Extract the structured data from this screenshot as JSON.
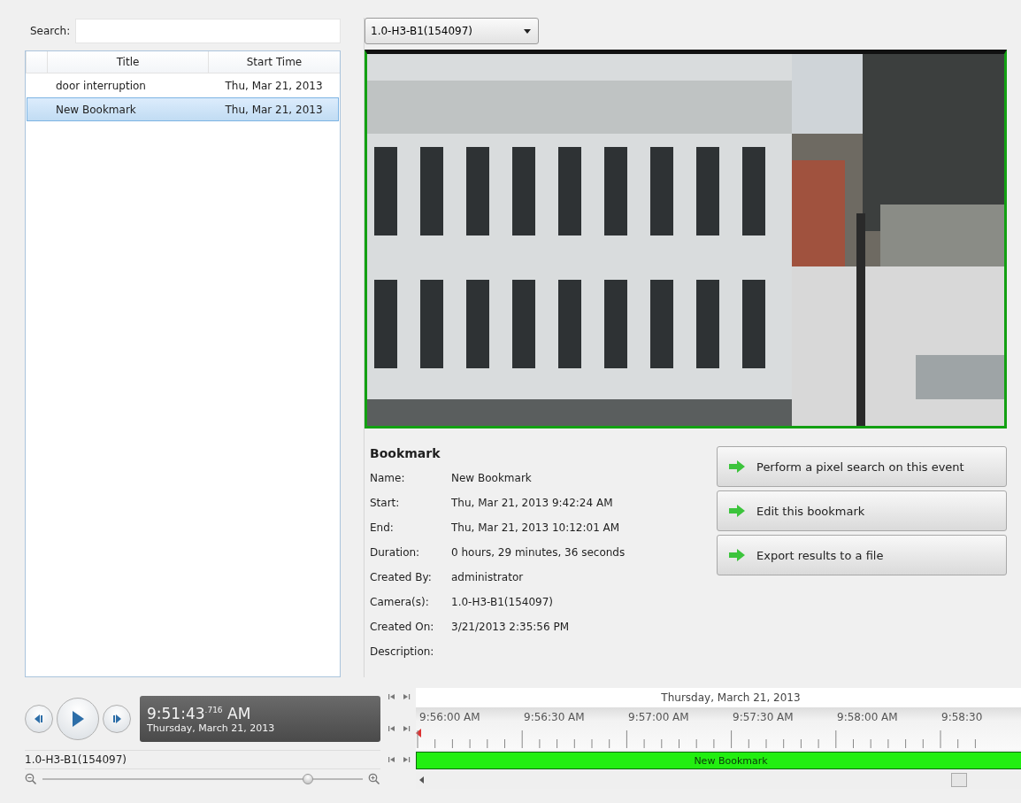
{
  "search": {
    "label": "Search:"
  },
  "bookmarks": {
    "columns": [
      "Title",
      "Start Time"
    ],
    "rows": [
      {
        "title": "door interruption",
        "start": "Thu, Mar 21, 2013",
        "selected": false
      },
      {
        "title": "New Bookmark",
        "start": "Thu, Mar 21, 2013",
        "selected": true
      }
    ]
  },
  "camera_select": {
    "value": "1.0-H3-B1(154097)"
  },
  "details": {
    "heading": "Bookmark",
    "fields": [
      {
        "label": "Name:",
        "value": "New Bookmark"
      },
      {
        "label": "Start:",
        "value": "Thu, Mar 21, 2013 9:42:24 AM"
      },
      {
        "label": "End:",
        "value": "Thu, Mar 21, 2013 10:12:01 AM"
      },
      {
        "label": "Duration:",
        "value": "0 hours, 29 minutes, 36 seconds"
      },
      {
        "label": "Created By:",
        "value": "administrator"
      },
      {
        "label": "Camera(s):",
        "value": "1.0-H3-B1(154097)"
      },
      {
        "label": "Created On:",
        "value": "3/21/2013 2:35:56 PM"
      },
      {
        "label": "Description:"
      }
    ]
  },
  "actions": [
    "Perform a pixel search on this event",
    "Edit this bookmark",
    "Export results to a file"
  ],
  "player": {
    "time": "9:51:43$^{.716}$ AM",
    "date": "Thursday, March 21, 2013",
    "camera": "1.0-H3-B1(154097)",
    "zoom": {
      "level": 0.84
    }
  },
  "timeline": {
    "date": "Thursday, March 21, 2013",
    "ticks": [
      "9:56:00 AM",
      "9:56:30 AM",
      "9:57:00 AM",
      "9:57:30 AM",
      "9:58:00 AM",
      "9:58:30"
    ],
    "bookmark": "New Bookmark"
  }
}
